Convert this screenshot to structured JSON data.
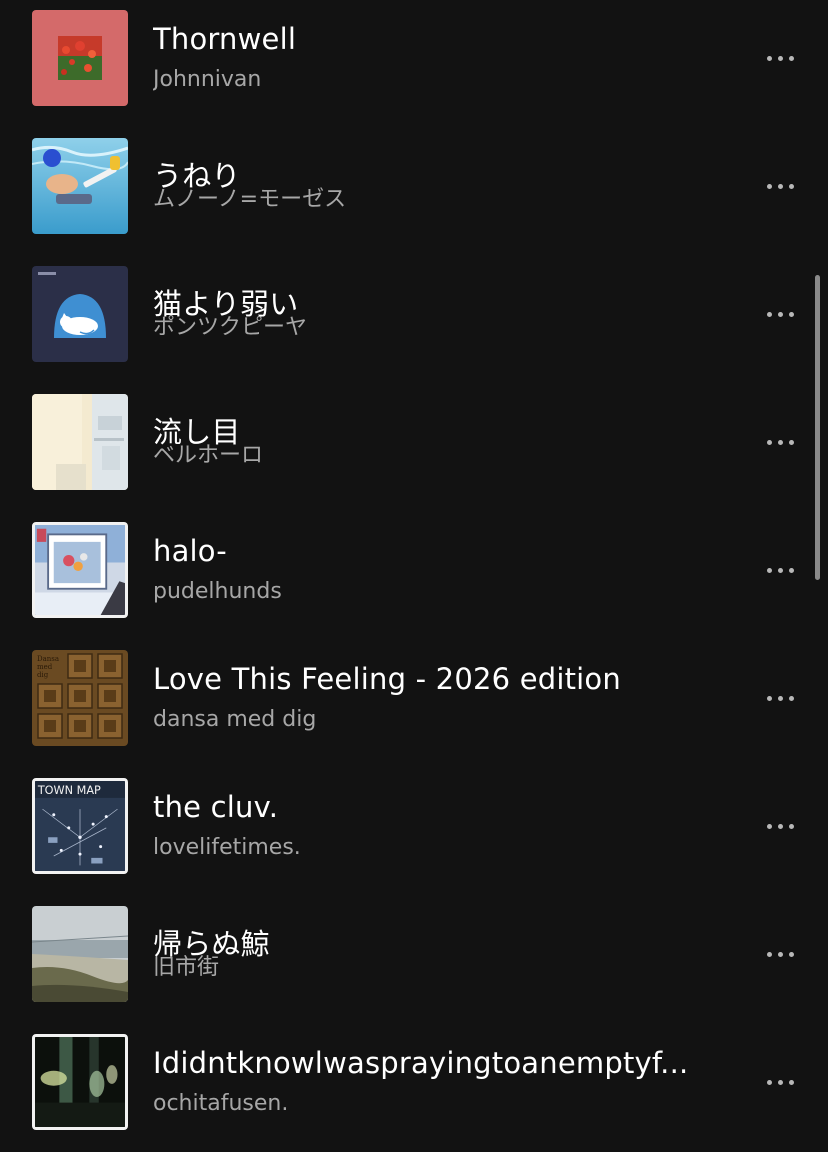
{
  "tracks": [
    {
      "title": "Thornwell",
      "artist": "Johnnivan",
      "art": "red-flower-field-art"
    },
    {
      "title": "うねり",
      "artist": "ムノーノ=モーゼス",
      "art": "underwater-swimmer-guitar-art"
    },
    {
      "title": "猫より弱い",
      "artist": "ポンツクピーヤ",
      "art": "sleeping-cat-art"
    },
    {
      "title": "流し目",
      "artist": "ベルホーロ",
      "art": "pale-building-art"
    },
    {
      "title": "halo-",
      "artist": "pudelhunds",
      "art": "collage-art"
    },
    {
      "title": "Love This Feeling - 2026 edition",
      "artist": "dansa med dig",
      "art": "chocolate-grid-art",
      "art_text": [
        "Dansa",
        "med",
        "dig"
      ]
    },
    {
      "title": "the cluv.",
      "artist": "lovelifetimes.",
      "art": "town-map-art",
      "art_text": "TOWN MAP"
    },
    {
      "title": "帰らぬ鯨",
      "artist": "旧市街",
      "art": "seaside-shore-art"
    },
    {
      "title": "Ididntknowlwasprayingtoanemptyf...",
      "artist": "ochitafusen.",
      "art": "blurred-lights-art"
    }
  ],
  "more_icon": "more-horizontal-icon",
  "colors": {
    "background": "#121212",
    "title": "#ffffff",
    "artist": "#a7a7a7",
    "dots": "#b8b8b8"
  }
}
